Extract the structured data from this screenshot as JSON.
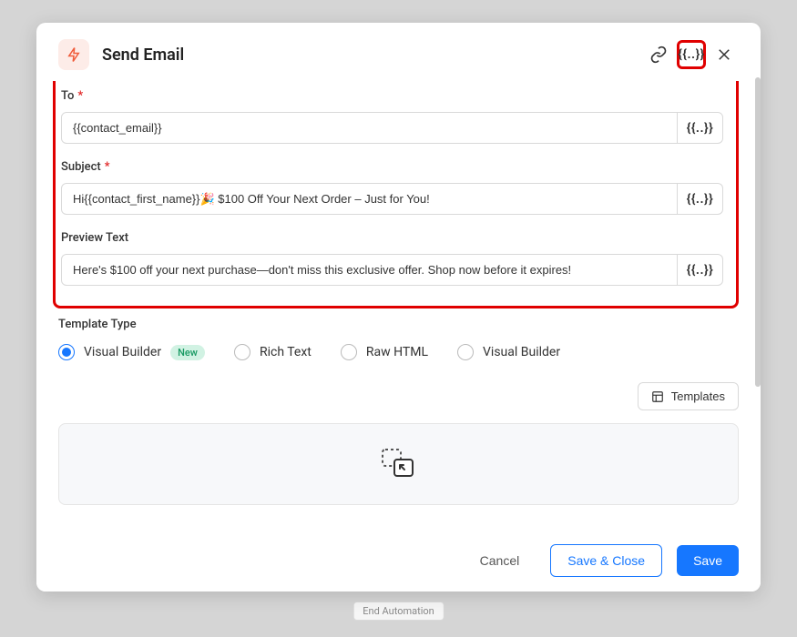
{
  "backdrop": {
    "button_label": "End Automation"
  },
  "header": {
    "title": "Send Email"
  },
  "form": {
    "to": {
      "label": "To",
      "value": "{{contact_email}}"
    },
    "subject": {
      "label": "Subject",
      "value": "Hi{{contact_first_name}}🎉 $100 Off Your Next Order – Just for You!"
    },
    "preview": {
      "label": "Preview Text",
      "value": "Here's $100 off your next purchase—don't miss this exclusive offer. Shop now before it expires!"
    },
    "merge_token": "{{..}}"
  },
  "template_type": {
    "label": "Template Type",
    "new_badge": "New",
    "options": [
      "Visual Builder",
      "Rich Text",
      "Raw HTML",
      "Visual Builder"
    ]
  },
  "templates_button": "Templates",
  "footer": {
    "cancel": "Cancel",
    "save_close": "Save & Close",
    "save": "Save"
  }
}
